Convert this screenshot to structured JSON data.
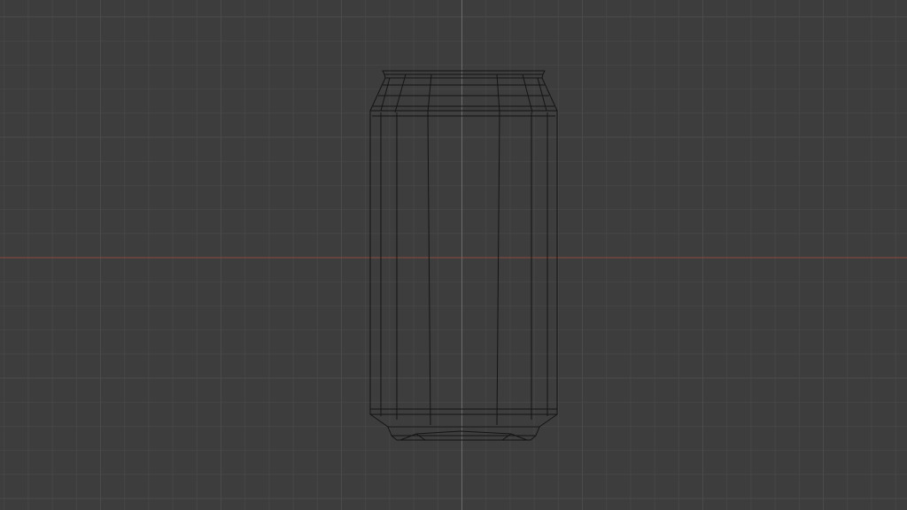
{
  "viewport": {
    "view": "front-orthographic",
    "shading": "wireframe",
    "colors": {
      "background": "#3d3d3d",
      "grid_minor": "#474747",
      "grid_major": "#4b4b4b",
      "x_axis": "#8a4b3d",
      "z_axis": "#3d77a3",
      "wire": "#141414"
    }
  },
  "object": {
    "type": "mesh",
    "shape": "beverage-can",
    "display": "wireframe"
  }
}
